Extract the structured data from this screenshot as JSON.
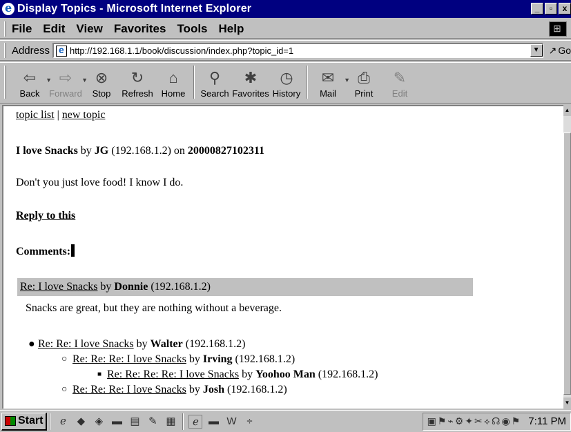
{
  "window": {
    "title": "Display Topics - Microsoft Internet Explorer",
    "controls": {
      "minimize": "_",
      "restore": "▫",
      "close": "x"
    }
  },
  "menu": [
    "File",
    "Edit",
    "View",
    "Favorites",
    "Tools",
    "Help"
  ],
  "address": {
    "label": "Address",
    "url": "http://192.168.1.1/book/discussion/index.php?topic_id=1",
    "go_label": "Go"
  },
  "toolbar": [
    {
      "label": "Back",
      "icon": "back-arrow-icon",
      "glyph": "⇦",
      "dropdown": true,
      "disabled": false
    },
    {
      "label": "Forward",
      "icon": "forward-arrow-icon",
      "glyph": "⇨",
      "dropdown": true,
      "disabled": true
    },
    {
      "label": "Stop",
      "icon": "stop-icon",
      "glyph": "⊗",
      "dropdown": false,
      "disabled": false
    },
    {
      "label": "Refresh",
      "icon": "refresh-icon",
      "glyph": "↻",
      "dropdown": false,
      "disabled": false
    },
    {
      "label": "Home",
      "icon": "home-icon",
      "glyph": "⌂",
      "dropdown": false,
      "disabled": false
    },
    {
      "label": "Search",
      "icon": "search-icon",
      "glyph": "⚲",
      "dropdown": false,
      "disabled": false
    },
    {
      "label": "Favorites",
      "icon": "favorites-icon",
      "glyph": "✱",
      "dropdown": false,
      "disabled": false
    },
    {
      "label": "History",
      "icon": "history-icon",
      "glyph": "◷",
      "dropdown": false,
      "disabled": false
    },
    {
      "label": "Mail",
      "icon": "mail-icon",
      "glyph": "✉",
      "dropdown": true,
      "disabled": false
    },
    {
      "label": "Print",
      "icon": "print-icon",
      "glyph": "⎙",
      "dropdown": false,
      "disabled": false
    },
    {
      "label": "Edit",
      "icon": "edit-icon",
      "glyph": "✎",
      "dropdown": false,
      "disabled": true
    }
  ],
  "page": {
    "nav": {
      "topic_list": "topic list",
      "separator": "|",
      "new_topic": "new topic"
    },
    "topic": {
      "title": "I love Snacks",
      "by": "by",
      "author": "JG",
      "ip": "(192.168.1.2)",
      "on": "on",
      "date": "20000827102311"
    },
    "body": "Don't you just love food! I know I do.",
    "reply_link": "Reply to this",
    "comments_heading": "Comments:",
    "first_comment": {
      "subject": "Re: I love Snacks",
      "by": "by",
      "author": "Donnie",
      "ip": "(192.168.1.2)",
      "body": "Snacks are great, but they are nothing without a beverage."
    },
    "thread": [
      {
        "subject": "Re: Re: I love Snacks",
        "by": "by",
        "author": "Walter",
        "ip": "(192.168.1.2)"
      },
      {
        "subject": "Re: Re: Re: I love Snacks",
        "by": "by",
        "author": "Irving",
        "ip": "(192.168.1.2)"
      },
      {
        "subject": "Re: Re: Re: Re: I love Snacks",
        "by": "by",
        "author": "Yoohoo Man",
        "ip": "(192.168.1.2)"
      },
      {
        "subject": "Re: Re: Re: I love Snacks",
        "by": "by",
        "author": "Josh",
        "ip": "(192.168.1.2)"
      }
    ]
  },
  "taskbar": {
    "start_label": "Start",
    "clock": "7:11 PM"
  }
}
